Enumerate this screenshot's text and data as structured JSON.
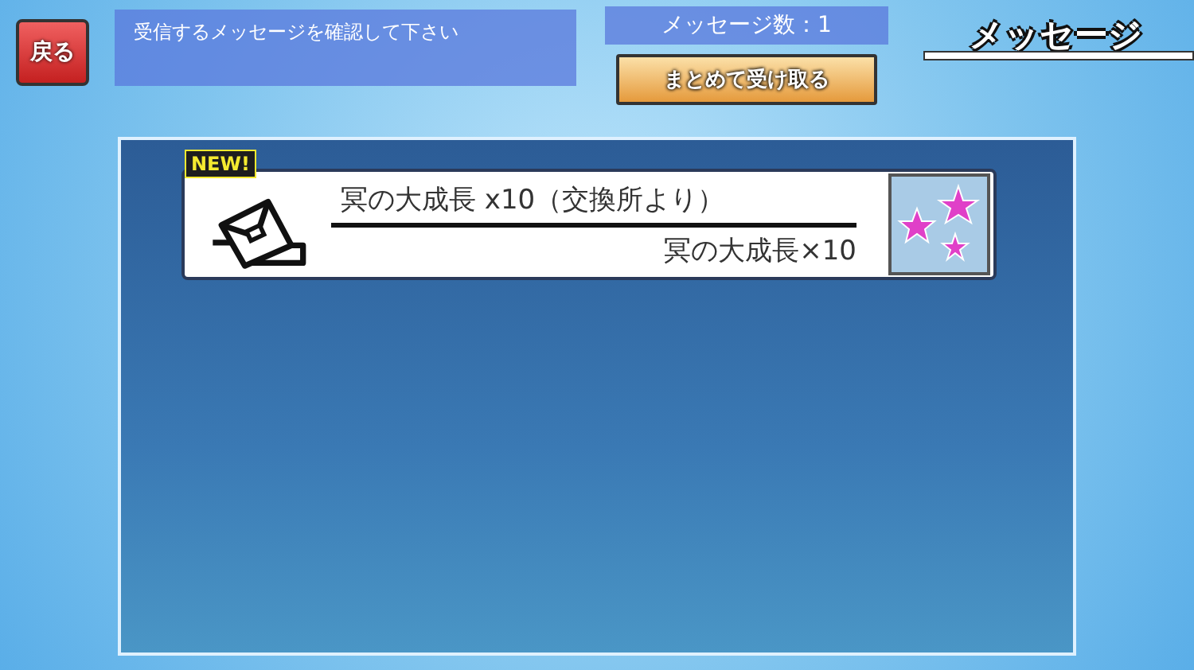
{
  "header": {
    "back_button": "戻る",
    "instruction": "受信するメッセージを確認して下さい",
    "message_count": "メッセージ数：1",
    "collect_all_button": "まとめて受け取る",
    "title": "メッセージ"
  },
  "messages": [
    {
      "badge": "NEW!",
      "title": "冥の大成長 x10（交換所より）",
      "item": "冥の大成長×10"
    }
  ]
}
